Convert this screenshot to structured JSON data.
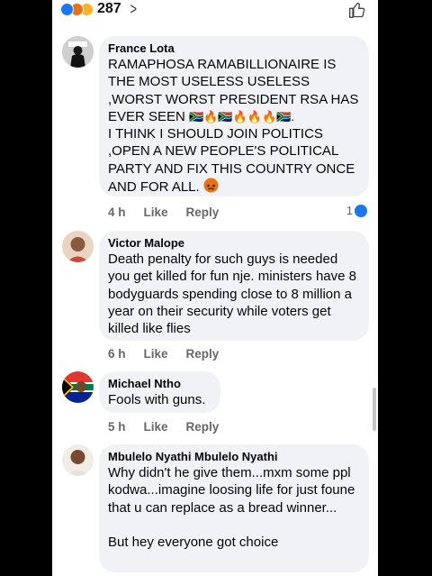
{
  "header": {
    "reaction_count": "287",
    "icons": [
      "like-reaction-icon",
      "angry-reaction-icon",
      "sad-reaction-icon",
      "chevron-right-icon",
      "thumbs-up-outline-icon"
    ]
  },
  "comments": [
    {
      "author": "France Lota",
      "text": "RAMAPHOSA RAMABILLIONAIRE IS THE MOST USELESS USELESS ,WORST WORST PRESIDENT  RSA HAS EVER SEEN",
      "emojis_line1": "🇿🇦🔥🇿🇦🔥🔥🔥🇿🇦.",
      "text2": "I THINK I SHOULD JOIN POLITICS ,OPEN A NEW PEOPLE'S POLITICAL PARTY AND FIX THIS COUNTRY ONCE AND FOR ALL.",
      "time": "4 h",
      "like": "Like",
      "reply": "Reply",
      "reactions": "1"
    },
    {
      "author": "Victor Malope",
      "text": "Death penalty for such guys is needed you get killed for fun nje.  ministers have 8 bodyguards spending close to 8 million a year on their security while voters get killed like flies",
      "time": "6 h",
      "like": "Like",
      "reply": "Reply"
    },
    {
      "author": "Michael Ntho",
      "text": "Fools with guns.",
      "time": "5 h",
      "like": "Like",
      "reply": "Reply"
    },
    {
      "author": "Mbulelo Nyathi Mbulelo Nyathi",
      "text": "Why didn't he give them...mxm some ppl kodwa...imagine loosing life for just foune that u can replace as a bread winner...",
      "text2": "But hey everyone got choice"
    }
  ],
  "colors": {
    "accent": "#1877f2",
    "bubble": "#f0f2f5",
    "meta": "#65676b",
    "angry": "#e9710f"
  }
}
